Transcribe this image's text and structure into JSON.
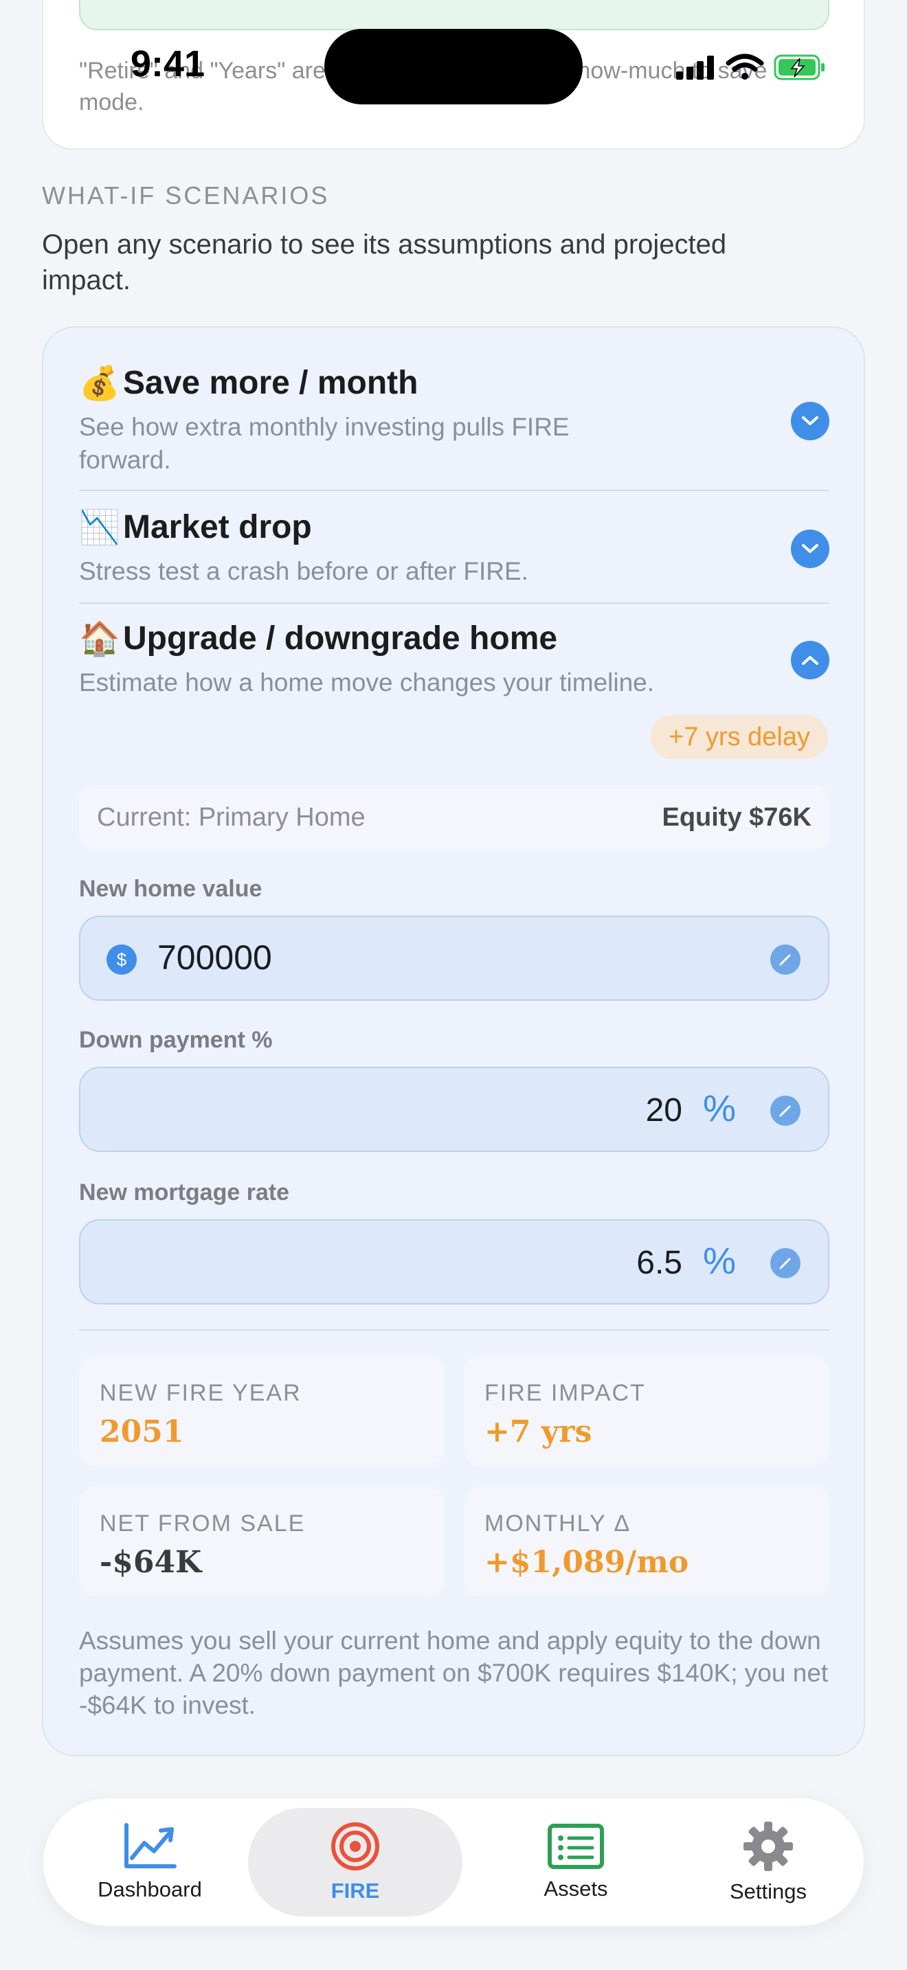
{
  "status_bar": {
    "time": "9:41"
  },
  "top_card": {
    "note": "\"Retire\" and \"Years\" are computed with the new how-much to save mode."
  },
  "section": {
    "title": "WHAT-IF SCENARIOS",
    "description": "Open any scenario to see its assumptions and projected impact."
  },
  "scenarios": [
    {
      "emoji": "💰",
      "title": "Save more / month",
      "description": "See how extra monthly investing pulls FIRE forward.",
      "expanded": false
    },
    {
      "emoji": "📉",
      "title": "Market drop",
      "description": "Stress test a crash before or after FIRE.",
      "expanded": false
    },
    {
      "emoji": "🏠",
      "title": "Upgrade / downgrade home",
      "description": "Estimate how a home move changes your timeline.",
      "expanded": true
    }
  ],
  "home_scenario": {
    "delay_badge": "+7 yrs delay",
    "current_label": "Current: Primary Home",
    "current_equity": "Equity $76K",
    "fields": {
      "home_value": {
        "label": "New home value",
        "value": "700000",
        "prefix": "$"
      },
      "down_payment": {
        "label": "Down payment %",
        "value": "20",
        "unit": "%"
      },
      "mortgage_rate": {
        "label": "New mortgage rate",
        "value": "6.5",
        "unit": "%"
      }
    },
    "stats": {
      "fire_year": {
        "label": "NEW FIRE YEAR",
        "value": "2051"
      },
      "fire_impact": {
        "label": "FIRE IMPACT",
        "value": "+7 yrs"
      },
      "net_from_sale": {
        "label": "NET FROM SALE",
        "value": "-$64K"
      },
      "monthly_delta": {
        "label": "MONTHLY Δ",
        "value": "+$1,089/mo"
      }
    },
    "footnote": "Assumes you sell your current home and apply equity to the down payment. A 20% down payment on $700K requires $140K; you net -$64K to invest."
  },
  "tabs": [
    {
      "label": "Dashboard",
      "icon": "chart-icon"
    },
    {
      "label": "FIRE",
      "icon": "target-icon",
      "active": true
    },
    {
      "label": "Assets",
      "icon": "list-icon"
    },
    {
      "label": "Settings",
      "icon": "gear-icon"
    }
  ],
  "colors": {
    "accent": "#3f8ee9",
    "warning": "#ef9a2e",
    "fire_tab": "#e8533a",
    "assets_icon": "#2e9f56"
  }
}
